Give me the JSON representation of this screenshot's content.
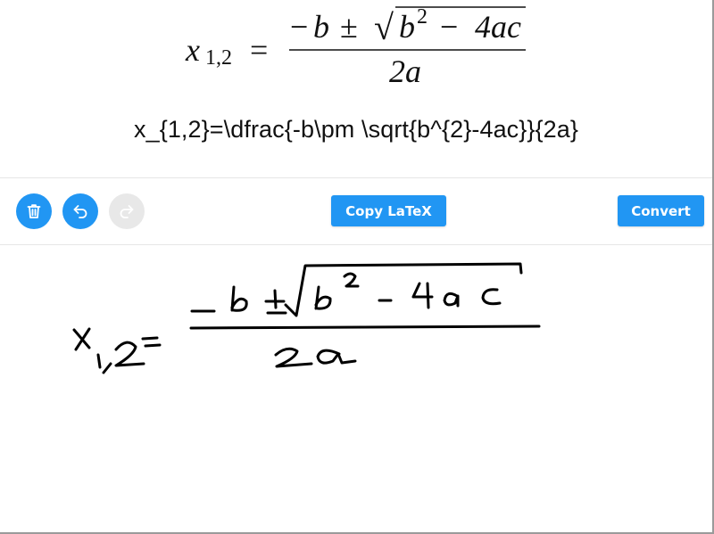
{
  "preview": {
    "rendered": {
      "lhs_var": "x",
      "lhs_sub": "1,2",
      "equals": "=",
      "num_minus": "−",
      "num_b": "b",
      "num_pm": "±",
      "sqrt_symbol": "√",
      "rad_b": "b",
      "rad_exp": "2",
      "rad_minus": "−",
      "rad_4ac": "4ac",
      "den": "2a"
    },
    "latex": "x_{1,2}=\\dfrac{-b\\pm \\sqrt{b^{2}-4ac}}{2a}"
  },
  "toolbar": {
    "delete_icon": "trash-icon",
    "undo_icon": "undo-icon",
    "redo_icon": "redo-icon",
    "copy_label": "Copy LaTeX",
    "convert_label": "Convert",
    "accent_color": "#2196f3",
    "disabled_color": "#e8e8e8"
  },
  "canvas": {
    "ink_color": "#000000"
  }
}
